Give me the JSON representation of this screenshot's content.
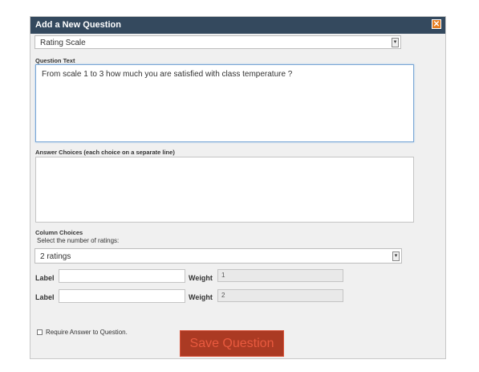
{
  "dialog": {
    "title": "Add a New Question",
    "close_glyph": "✕"
  },
  "question_type": {
    "selected": "Rating Scale",
    "arrow_glyph": "▾"
  },
  "question_text": {
    "label": "Question Text",
    "value": "From scale 1 to 3 how much you are satisfied with class temperature ?"
  },
  "answer_choices": {
    "label": "Answer Choices (each choice on a separate line)",
    "value": ""
  },
  "column_choices": {
    "label": "Column Choices",
    "hint": "Select the number of ratings:",
    "selected": "2 ratings",
    "arrow_glyph": "▾"
  },
  "ratings": [
    {
      "label_text": "Label",
      "label_value": "",
      "weight_text": "Weight",
      "weight_value": "1"
    },
    {
      "label_text": "Label",
      "label_value": "",
      "weight_text": "Weight",
      "weight_value": "2"
    }
  ],
  "require_answer": {
    "label": "Require Answer to Question.",
    "checked": false
  },
  "save_button": {
    "label": "Save Question"
  },
  "colors": {
    "titlebar": "#34495e",
    "close": "#e67e22",
    "save_button_bg": "#ab3a23",
    "save_button_text": "#e85a3f"
  }
}
